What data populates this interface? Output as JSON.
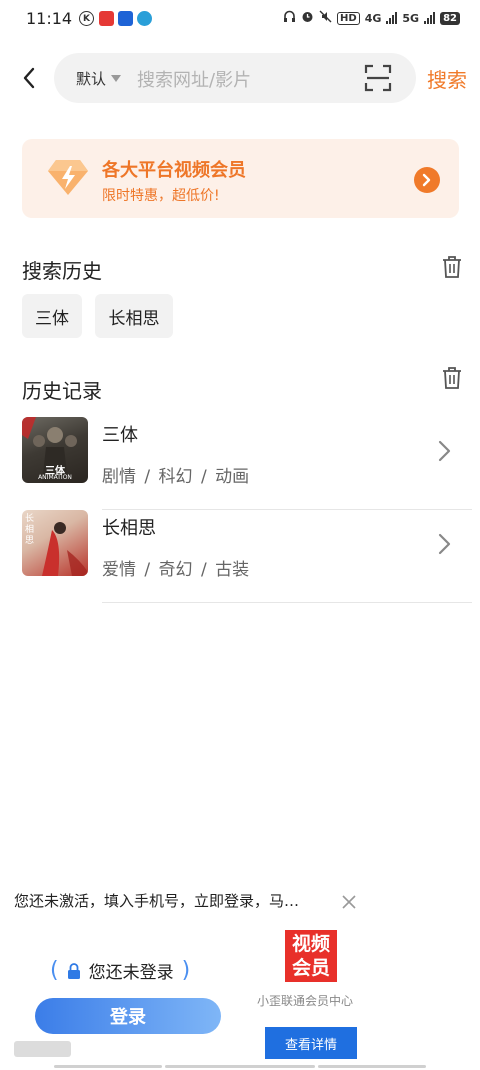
{
  "status_bar": {
    "time": "11:14",
    "network_4g": "4G",
    "network_5g": "5G",
    "hd_label": "HD",
    "battery": "82"
  },
  "search": {
    "engine_selected": "默认",
    "placeholder": "搜索网址/影片",
    "submit_label": "搜索"
  },
  "banner": {
    "title": "各大平台视频会员",
    "subtitle": "限时特惠，超低价!"
  },
  "search_history": {
    "title": "搜索历史",
    "chips": [
      "三体",
      "长相思"
    ]
  },
  "history_records": {
    "title": "历史记录",
    "items": [
      {
        "title": "三体",
        "tags": "剧情 / 科幻 / 动画",
        "poster_text": "三体",
        "poster_sub": "ANIMATION"
      },
      {
        "title": "长相思",
        "tags": "爱情 / 奇幻 / 古装",
        "poster_text": "长相思"
      }
    ]
  },
  "ad": {
    "text": "您还未激活，填入手机号，立即登录，马…",
    "login_status": "您还未登录",
    "login_button": "登录",
    "vip_logo_line1": "视频",
    "vip_logo_line2": "会员",
    "vip_center": "小歪联通会员中心",
    "detail_button": "查看详情"
  },
  "colors": {
    "accent": "#f07a2a",
    "blue": "#1f6fe0",
    "red": "#e8302a"
  }
}
